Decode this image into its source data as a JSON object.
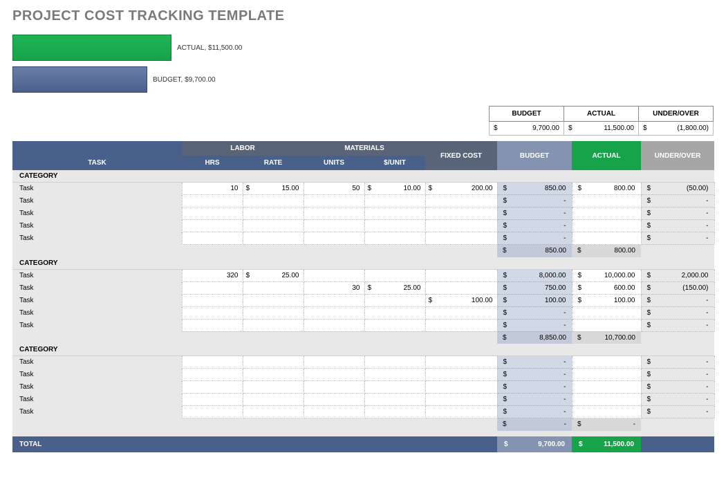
{
  "title": "PROJECT COST TRACKING TEMPLATE",
  "chart_data": {
    "type": "bar",
    "categories": [
      "ACTUAL",
      "BUDGET"
    ],
    "values": [
      11500.0,
      9700.0
    ],
    "labels": [
      "ACTUAL,  $11,500.00",
      "BUDGET,  $9,700.00"
    ]
  },
  "summary": {
    "headers": {
      "budget": "BUDGET",
      "actual": "ACTUAL",
      "uo": "UNDER/OVER"
    },
    "budget": "9,700.00",
    "actual": "11,500.00",
    "uo": "(1,800.00)"
  },
  "headers": {
    "task": "TASK",
    "labor": "LABOR",
    "materials": "MATERIALS",
    "hrs": "HRS",
    "rate": "RATE",
    "units": "UNITS",
    "punit": "$/UNIT",
    "fixed": "FIXED COST",
    "budget": "BUDGET",
    "actual": "ACTUAL",
    "uo": "UNDER/OVER"
  },
  "categories": [
    {
      "name": "CATEGORY",
      "tasks": [
        {
          "name": "Task",
          "hrs": "10",
          "rate": "15.00",
          "units": "50",
          "punit": "10.00",
          "fixed": "200.00",
          "budget": "850.00",
          "actual": "800.00",
          "uo": "(50.00)"
        },
        {
          "name": "Task",
          "hrs": "",
          "rate": "",
          "units": "",
          "punit": "",
          "fixed": "",
          "budget": "-",
          "actual": "",
          "uo": "-"
        },
        {
          "name": "Task",
          "hrs": "",
          "rate": "",
          "units": "",
          "punit": "",
          "fixed": "",
          "budget": "-",
          "actual": "",
          "uo": "-"
        },
        {
          "name": "Task",
          "hrs": "",
          "rate": "",
          "units": "",
          "punit": "",
          "fixed": "",
          "budget": "-",
          "actual": "",
          "uo": "-"
        },
        {
          "name": "Task",
          "hrs": "",
          "rate": "",
          "units": "",
          "punit": "",
          "fixed": "",
          "budget": "-",
          "actual": "",
          "uo": "-"
        }
      ],
      "subtotal": {
        "budget": "850.00",
        "actual": "800.00"
      }
    },
    {
      "name": "CATEGORY",
      "tasks": [
        {
          "name": "Task",
          "hrs": "320",
          "rate": "25.00",
          "units": "",
          "punit": "",
          "fixed": "",
          "budget": "8,000.00",
          "actual": "10,000.00",
          "uo": "2,000.00"
        },
        {
          "name": "Task",
          "hrs": "",
          "rate": "",
          "units": "30",
          "punit": "25.00",
          "fixed": "",
          "budget": "750.00",
          "actual": "600.00",
          "uo": "(150.00)"
        },
        {
          "name": "Task",
          "hrs": "",
          "rate": "",
          "units": "",
          "punit": "",
          "fixed": "100.00",
          "budget": "100.00",
          "actual": "100.00",
          "uo": "-"
        },
        {
          "name": "Task",
          "hrs": "",
          "rate": "",
          "units": "",
          "punit": "",
          "fixed": "",
          "budget": "-",
          "actual": "",
          "uo": "-"
        },
        {
          "name": "Task",
          "hrs": "",
          "rate": "",
          "units": "",
          "punit": "",
          "fixed": "",
          "budget": "-",
          "actual": "",
          "uo": "-"
        }
      ],
      "subtotal": {
        "budget": "8,850.00",
        "actual": "10,700.00"
      }
    },
    {
      "name": "CATEGORY",
      "tasks": [
        {
          "name": "Task",
          "hrs": "",
          "rate": "",
          "units": "",
          "punit": "",
          "fixed": "",
          "budget": "-",
          "actual": "",
          "uo": "-"
        },
        {
          "name": "Task",
          "hrs": "",
          "rate": "",
          "units": "",
          "punit": "",
          "fixed": "",
          "budget": "-",
          "actual": "",
          "uo": "-"
        },
        {
          "name": "Task",
          "hrs": "",
          "rate": "",
          "units": "",
          "punit": "",
          "fixed": "",
          "budget": "-",
          "actual": "",
          "uo": "-"
        },
        {
          "name": "Task",
          "hrs": "",
          "rate": "",
          "units": "",
          "punit": "",
          "fixed": "",
          "budget": "-",
          "actual": "",
          "uo": "-"
        },
        {
          "name": "Task",
          "hrs": "",
          "rate": "",
          "units": "",
          "punit": "",
          "fixed": "",
          "budget": "-",
          "actual": "",
          "uo": "-"
        }
      ],
      "subtotal": {
        "budget": "-",
        "actual": "-"
      }
    }
  ],
  "total": {
    "label": "TOTAL",
    "budget": "9,700.00",
    "actual": "11,500.00"
  }
}
